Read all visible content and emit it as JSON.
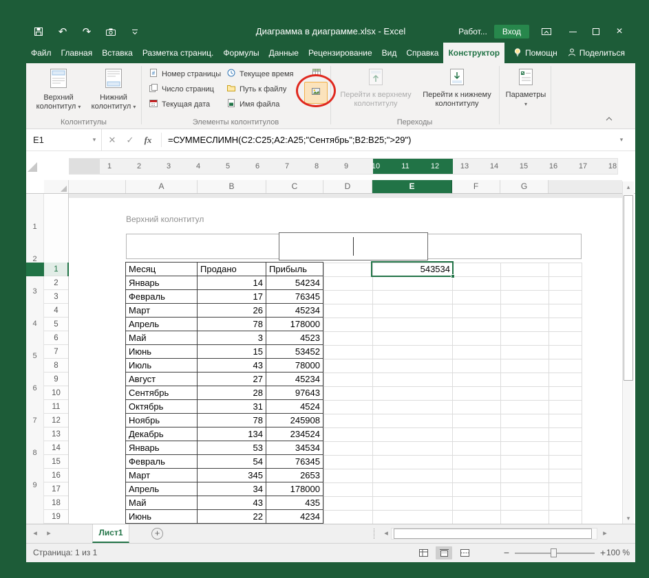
{
  "colors": {
    "accent_green": "#217346",
    "titlebar_green": "#1D5C38",
    "annotation_red": "#E0281E",
    "highlight_orange": "#FBE3BC"
  },
  "titlebar": {
    "title": "Диаграмма в диаграмме.xlsx - Excel",
    "account_label": "Работ...",
    "signin_label": "Вход",
    "qat_icons": [
      "save",
      "undo",
      "redo",
      "camera",
      "customize-quick-access"
    ],
    "window_controls": [
      "minimize",
      "maximize",
      "close"
    ]
  },
  "ribbon_tabs": {
    "items": [
      {
        "label": "Файл",
        "active": false
      },
      {
        "label": "Главная",
        "active": false
      },
      {
        "label": "Вставка",
        "active": false
      },
      {
        "label": "Разметка страниц.",
        "active": false
      },
      {
        "label": "Формулы",
        "active": false
      },
      {
        "label": "Данные",
        "active": false
      },
      {
        "label": "Рецензирование",
        "active": false
      },
      {
        "label": "Вид",
        "active": false
      },
      {
        "label": "Справка",
        "active": false
      },
      {
        "label": "Конструктор",
        "active": true
      }
    ],
    "help_label": "Помощн",
    "share_label": "Поделиться"
  },
  "ribbon": {
    "kolontituly": {
      "label": "Колонтитулы",
      "header_button": {
        "line1": "Верхний",
        "line2": "колонтитул"
      },
      "footer_button": {
        "line1": "Нижний",
        "line2": "колонтитул"
      }
    },
    "elements": {
      "label": "Элементы колонтитулов",
      "buttons": [
        {
          "label": "Номер страницы",
          "icon": "page-number"
        },
        {
          "label": "Число страниц",
          "icon": "page-count"
        },
        {
          "label": "Текущая дата",
          "icon": "current-date"
        },
        {
          "label": "Текущее время",
          "icon": "current-time"
        },
        {
          "label": "Путь к файлу",
          "icon": "file-path"
        },
        {
          "label": "Имя файла",
          "icon": "file-name"
        }
      ],
      "icon_buttons": [
        {
          "icon": "sheet-name",
          "highlighted": false
        },
        {
          "icon": "picture",
          "highlighted": true
        }
      ]
    },
    "transitions": {
      "label": "Переходы",
      "buttons": [
        {
          "line1": "Перейти к верхнему",
          "line2": "колонтитулу",
          "disabled": true
        },
        {
          "line1": "Перейти к нижнему",
          "line2": "колонтитулу",
          "disabled": false
        }
      ]
    },
    "options": {
      "button_label": "Параметры"
    }
  },
  "formula_bar": {
    "name_box": "E1",
    "formula": "=СУММЕСЛИМН(C2:C25;A2:A25;\"Сентябрь\";B2:B25;\">29\")"
  },
  "ruler": {
    "numbers": [
      1,
      2,
      3,
      4,
      5,
      6,
      7,
      8,
      9,
      10,
      11,
      12,
      13,
      14,
      15,
      16,
      17,
      18
    ],
    "highlighted": [
      10,
      11,
      12
    ]
  },
  "sheet": {
    "header_zone_label": "Верхний колонтитул",
    "columns": [
      "A",
      "B",
      "C",
      "D",
      "E",
      "F",
      "G"
    ],
    "selected_column": "E",
    "vertical_ruler_numbers": [
      1,
      2,
      3,
      4,
      5,
      6,
      7,
      8,
      9
    ],
    "selected_cell": {
      "ref": "E1",
      "column": "E",
      "row": 1,
      "value": "543534"
    },
    "table_rows": [
      [
        "Месяц",
        "Продано",
        "Прибыль"
      ],
      [
        "Январь",
        "14",
        "54234"
      ],
      [
        "Февраль",
        "17",
        "76345"
      ],
      [
        "Март",
        "26",
        "45234"
      ],
      [
        "Апрель",
        "78",
        "178000"
      ],
      [
        "Май",
        "3",
        "4523"
      ],
      [
        "Июнь",
        "15",
        "53452"
      ],
      [
        "Июль",
        "43",
        "78000"
      ],
      [
        "Август",
        "27",
        "45234"
      ],
      [
        "Сентябрь",
        "28",
        "97643"
      ],
      [
        "Октябрь",
        "31",
        "4524"
      ],
      [
        "Ноябрь",
        "78",
        "245908"
      ],
      [
        "Декабрь",
        "134",
        "234524"
      ],
      [
        "Январь",
        "53",
        "34534"
      ],
      [
        "Февраль",
        "54",
        "76345"
      ],
      [
        "Март",
        "345",
        "2653"
      ],
      [
        "Апрель",
        "34",
        "178000"
      ],
      [
        "Май",
        "43",
        "435"
      ],
      [
        "Июнь",
        "22",
        "4234"
      ]
    ]
  },
  "sheet_tabs": {
    "active": "Лист1"
  },
  "status_bar": {
    "page_info": "Страница: 1 из 1",
    "view_buttons": [
      {
        "icon": "normal-view",
        "active": false
      },
      {
        "icon": "page-layout",
        "active": true
      },
      {
        "icon": "page-break",
        "active": false
      }
    ],
    "zoom_label": "100 %"
  }
}
